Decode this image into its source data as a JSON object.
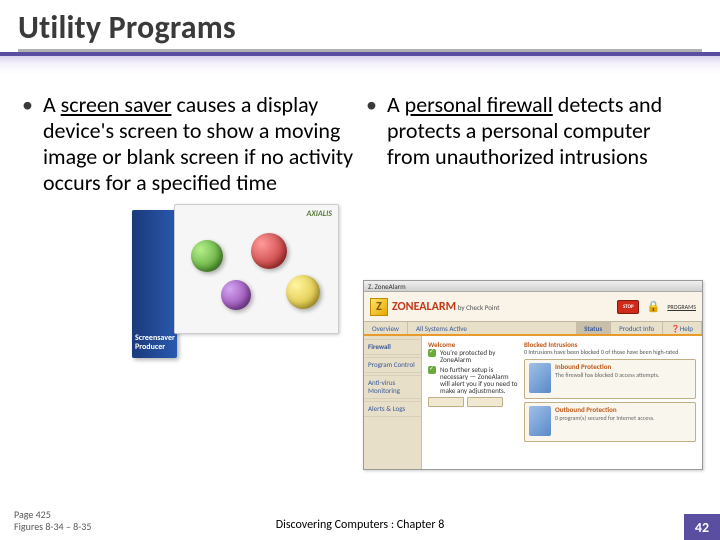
{
  "title": "Utility Programs",
  "left_bullet": {
    "prefix": "A ",
    "keyword": "screen saver",
    "rest": " causes a display device's screen to show a moving image or blank screen if no activity occurs for a specified time"
  },
  "right_bullet": {
    "prefix": "A ",
    "keyword": "personal firewall",
    "rest": " detects and protects a personal computer from unauthorized intrusions"
  },
  "screensaver_box": {
    "brand_line1": "Screensaver",
    "brand_line2": "Producer",
    "panel_logo": "AXIALIS"
  },
  "zonealarm": {
    "window_title": "Z. ZoneAlarm",
    "logo_letter": "Z",
    "logo_text": "ZONEALARM",
    "logo_sub": "by Check Point",
    "stop_label": "STOP",
    "programs_label": "PROGRAMS",
    "tabs": [
      "Overview",
      "All Systems Active",
      "Status",
      "Product Info"
    ],
    "help_label": "Help",
    "nav": [
      "Firewall",
      "Program Control",
      "Anti-virus Monitoring",
      "Alerts & Logs"
    ],
    "center_heading": "Welcome",
    "status1": "You're protected by ZoneAlarm",
    "status2": "No further setup is necessary — ZoneAlarm will alert you if you need to make any adjustments.",
    "protected_heading": "Blocked Intrusions",
    "protected_sub": "0 Intrusions have been blocked\n0 of those have been high-rated",
    "panel1_title": "Inbound Protection",
    "panel1_text": "The firewall has blocked 0 access attempts.",
    "panel2_title": "Outbound Protection",
    "panel2_text": "0 program(s) secured for Internet access."
  },
  "footer": {
    "page_ref_line1": "Page 425",
    "page_ref_line2": "Figures 8-34 – 8-35",
    "center": "Discovering Computers : Chapter 8",
    "slide_number": "42"
  }
}
